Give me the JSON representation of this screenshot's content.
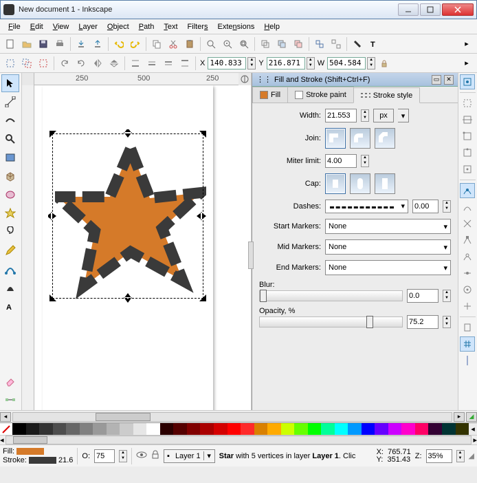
{
  "window": {
    "title": "New document 1 - Inkscape"
  },
  "menu": {
    "file": "File",
    "edit": "Edit",
    "view": "View",
    "layer": "Layer",
    "object": "Object",
    "path": "Path",
    "text": "Text",
    "filters": "Filters",
    "extensions": "Extensions",
    "help": "Help"
  },
  "tooloptions": {
    "x_label": "X",
    "x": "140.833",
    "y_label": "Y",
    "y": "216.871",
    "w_label": "W",
    "w": "504.584"
  },
  "ruler": {
    "m1": "250",
    "m2": "500",
    "m3": "250"
  },
  "panel": {
    "title": "Fill and Stroke (Shift+Ctrl+F)",
    "tabs": {
      "fill": "Fill",
      "stroke_paint": "Stroke paint",
      "stroke_style": "Stroke style"
    },
    "width_label": "Width:",
    "width": "21.553",
    "unit": "px",
    "join_label": "Join:",
    "miter_label": "Miter limit:",
    "miter": "4.00",
    "cap_label": "Cap:",
    "dashes_label": "Dashes:",
    "dash_offset": "0.00",
    "start_label": "Start Markers:",
    "start": "None",
    "mid_label": "Mid Markers:",
    "mid": "None",
    "end_label": "End Markers:",
    "end": "None",
    "blur_label": "Blur:",
    "blur": "0.0",
    "opacity_label": "Opacity, %",
    "opacity": "75.2"
  },
  "status": {
    "fill_label": "Fill:",
    "stroke_label": "Stroke:",
    "stroke_w": "21.6",
    "o_label": "O:",
    "o": "75",
    "layer": "Layer 1",
    "desc_prefix": "Star ",
    "desc_mid": "with 5 vertices in layer ",
    "desc_layer": "Layer 1",
    "desc_suffix": ". Clic",
    "x_label": "X:",
    "x": "765.71",
    "y_label": "Y:",
    "y": "351.43",
    "z_label": "Z:",
    "z": "35%"
  },
  "colors": {
    "fill": "#d57a29",
    "stroke": "#3a3a3a",
    "palette": [
      "#000000",
      "#1a1a1a",
      "#333333",
      "#4d4d4d",
      "#666666",
      "#808080",
      "#999999",
      "#b3b3b3",
      "#cccccc",
      "#e6e6e6",
      "#ffffff",
      "#2b0000",
      "#550000",
      "#800000",
      "#aa0000",
      "#d40000",
      "#ff0000",
      "#ff2a2a",
      "#d98000",
      "#ffaa00",
      "#ccff00",
      "#66ff00",
      "#00ff00",
      "#00ff99",
      "#00ffff",
      "#0099ff",
      "#0000ff",
      "#6600ff",
      "#cc00ff",
      "#ff00cc",
      "#ff0066",
      "#330033",
      "#003333",
      "#333300"
    ]
  }
}
